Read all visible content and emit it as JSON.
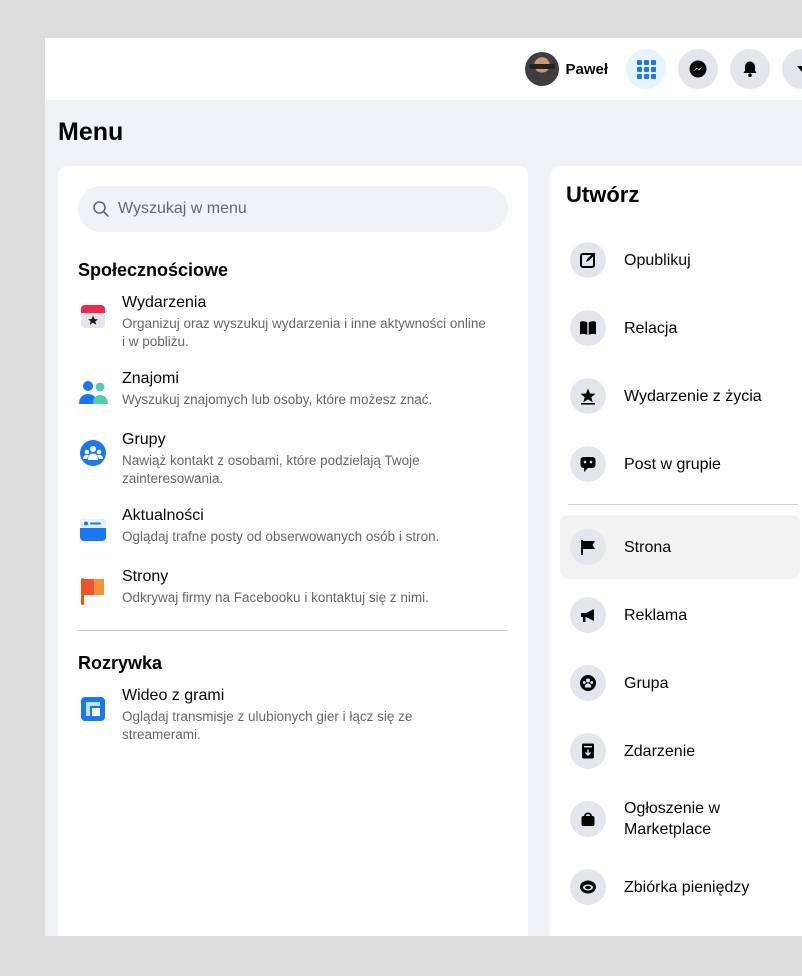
{
  "topbar": {
    "profile_name": "Paweł",
    "buttons": [
      "menu-grid-icon",
      "messenger-icon",
      "bell-icon",
      "account-caret-icon"
    ]
  },
  "menu": {
    "title": "Menu"
  },
  "search": {
    "placeholder": "Wyszukaj w menu"
  },
  "sections": [
    {
      "title": "Społecznościowe",
      "items": [
        {
          "icon": "calendar-icon",
          "title": "Wydarzenia",
          "desc": "Organizuj oraz wyszukuj wydarzenia i inne aktywności online i w pobliżu."
        },
        {
          "icon": "friends-icon",
          "title": "Znajomi",
          "desc": "Wyszukuj znajomych lub osoby, które możesz znać."
        },
        {
          "icon": "groups-icon",
          "title": "Grupy",
          "desc": "Nawiąż kontakt z osobami, które podzielają Twoje zainteresowania."
        },
        {
          "icon": "news-feed-icon",
          "title": "Aktualności",
          "desc": "Oglądaj trafne posty od obserwowanych osób i stron."
        },
        {
          "icon": "flag-icon",
          "title": "Strony",
          "desc": "Odkrywaj firmy na Facebooku i kontaktuj się z nimi."
        }
      ]
    },
    {
      "title": "Rozrywka",
      "items": [
        {
          "icon": "gaming-video-icon",
          "title": "Wideo z grami",
          "desc": "Oglądaj transmisje z ulubionych gier i łącz się ze streamerami."
        }
      ]
    }
  ],
  "create": {
    "title": "Utwórz",
    "items_top": [
      {
        "icon": "compose-icon",
        "label": "Opublikuj"
      },
      {
        "icon": "book-icon",
        "label": "Relacja"
      },
      {
        "icon": "life-event-star-icon",
        "label": "Wydarzenie z życia"
      },
      {
        "icon": "group-post-icon",
        "label": "Post w grupie"
      }
    ],
    "items_bottom": [
      {
        "icon": "page-flag-icon",
        "label": "Strona"
      },
      {
        "icon": "megaphone-icon",
        "label": "Reklama"
      },
      {
        "icon": "group-icon",
        "label": "Grupa"
      },
      {
        "icon": "event-calendar-icon",
        "label": "Zdarzenie"
      },
      {
        "icon": "marketplace-bag-icon",
        "label": "Ogłoszenie w Marketplace"
      },
      {
        "icon": "fundraiser-icon",
        "label": "Zbiórka pieniędzy"
      }
    ]
  },
  "colors": {
    "accent": "#1877f2",
    "background": "#f0f2f5",
    "text_secondary": "#65676b"
  }
}
